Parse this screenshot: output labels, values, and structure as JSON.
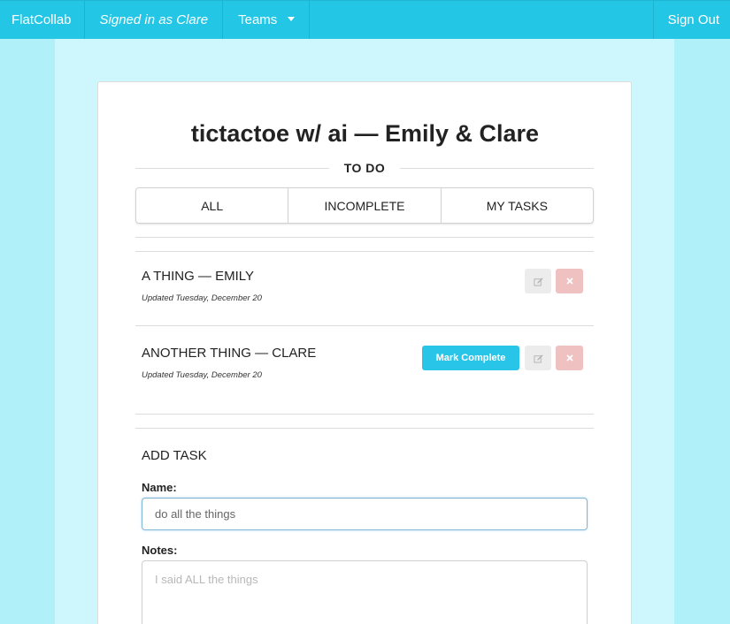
{
  "navbar": {
    "brand": "FlatCollab",
    "signed_in": "Signed in as Clare",
    "teams": "Teams",
    "sign_out": "Sign Out"
  },
  "project": {
    "title": "tictactoe w/ ai — Emily & Clare",
    "section": "TO DO"
  },
  "filters": [
    "ALL",
    "INCOMPLETE",
    "MY TASKS"
  ],
  "tasks": [
    {
      "title": "A THING — EMILY",
      "updated": "Updated Tuesday, December 20",
      "mark_complete": null
    },
    {
      "title": "ANOTHER THING — CLARE",
      "updated": "Updated Tuesday, December 20",
      "mark_complete": "Mark Complete"
    }
  ],
  "add_task": {
    "heading": "ADD TASK",
    "name_label": "Name:",
    "name_placeholder": "do all the things",
    "notes_label": "Notes:",
    "notes_placeholder": "I said ALL the things"
  },
  "icons": {
    "edit": "pencil-square-icon",
    "delete": "times-icon",
    "teams_caret": "caret-down-icon"
  },
  "colors": {
    "accent": "#24c6e6",
    "page_bg": "#b0f0f8",
    "content_bg": "#cdf7fc",
    "delete_btn": "#f0c1c1",
    "edit_btn": "#ececec"
  }
}
